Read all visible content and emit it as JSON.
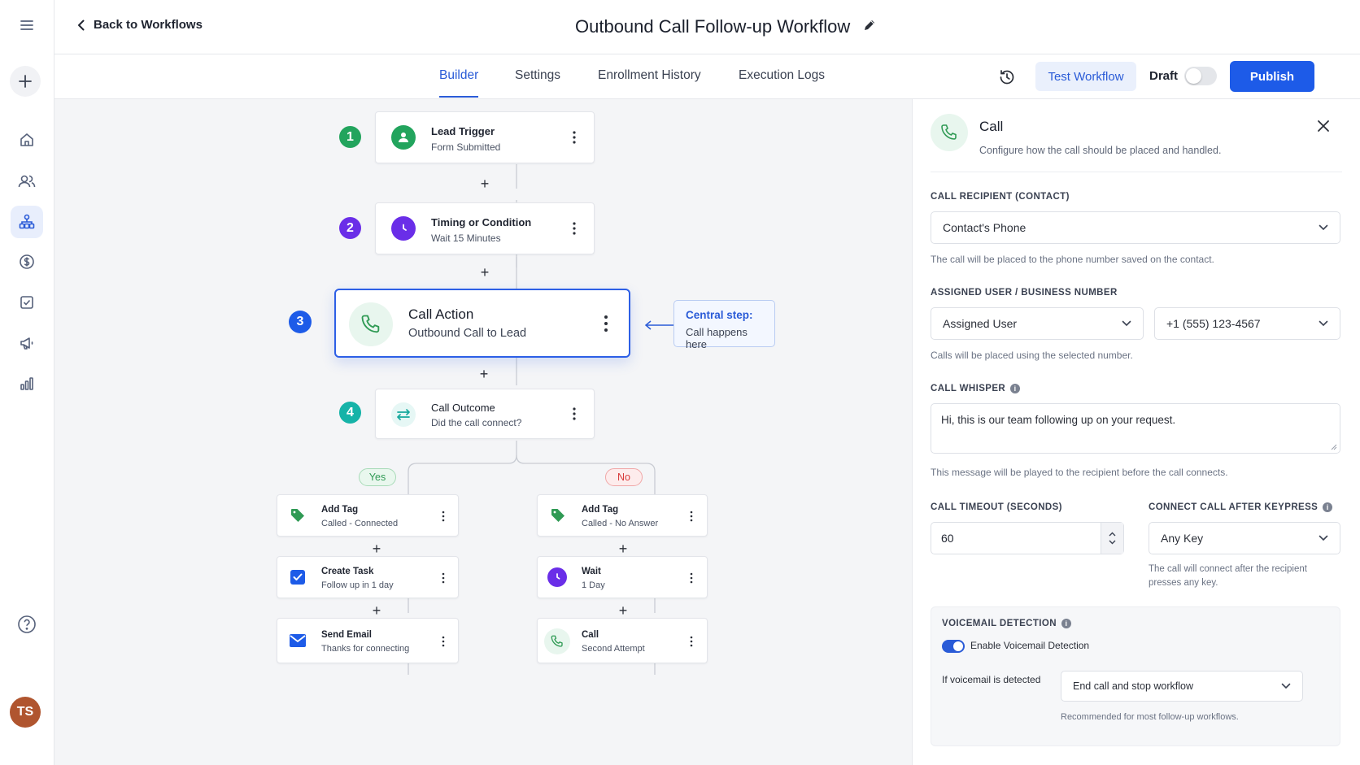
{
  "header": {
    "back_label": "Back to Workflows",
    "title": "Outbound Call Follow-up Workflow"
  },
  "tabs": [
    {
      "label": "Builder",
      "active": true
    },
    {
      "label": "Settings"
    },
    {
      "label": "Enrollment History"
    },
    {
      "label": "Execution Logs"
    }
  ],
  "actions": {
    "test_label": "Test Workflow",
    "draft_label": "Draft",
    "draft_enabled": false,
    "publish_label": "Publish"
  },
  "sidebar": {
    "icons": [
      "menu-icon",
      "plus-icon",
      "home-icon",
      "contacts-icon",
      "workflow-icon",
      "billing-icon",
      "tasks-icon",
      "marketing-icon",
      "reporting-icon",
      "help-icon"
    ],
    "active": "workflow-icon",
    "avatar_initials": "TS"
  },
  "workflow": {
    "steps": [
      {
        "num": "1",
        "title": "Lead Trigger",
        "subtitle": "Form Submitted",
        "color": "#22a45d"
      },
      {
        "num": "2",
        "title": "Timing or Condition",
        "subtitle": "Wait 15 Minutes",
        "color": "#6a2ee8"
      },
      {
        "num": "3",
        "title": "Call Action",
        "subtitle": "Outbound Call to Lead",
        "color": "#1d5be8"
      },
      {
        "num": "4",
        "title": "Call Outcome",
        "subtitle": "Did the call connect?",
        "color": "#16b3a8"
      }
    ],
    "callout": {
      "title": "Central step:",
      "text": "Call happens here"
    },
    "branches": {
      "yes_label": "Yes",
      "no_label": "No",
      "yes": [
        {
          "title": "Add Tag",
          "subtitle": "Called - Connected"
        },
        {
          "title": "Create Task",
          "subtitle": "Follow up in 1 day"
        },
        {
          "title": "Send Email",
          "subtitle": "Thanks for connecting"
        }
      ],
      "no": [
        {
          "title": "Add Tag",
          "subtitle": "Called - No Answer"
        },
        {
          "title": "Wait",
          "subtitle": "1 Day"
        },
        {
          "title": "Call",
          "subtitle": "Second Attempt"
        }
      ]
    }
  },
  "panel": {
    "title": "Call",
    "subtitle": "Configure how the call should be placed and handled.",
    "recipient": {
      "label": "CALL RECIPIENT (CONTACT)",
      "value": "Contact's Phone",
      "help": "The call will be placed to the phone number saved on the contact."
    },
    "assigned": {
      "label": "ASSIGNED USER / BUSINESS NUMBER",
      "user_value": "Assigned User",
      "number_value": "+1 (555) 123-4567",
      "help": "Calls will be placed using the selected number."
    },
    "whisper": {
      "label": "CALL WHISPER",
      "value": "Hi, this is our team following up on your request.",
      "help": "This message will be played to the recipient before the call connects."
    },
    "timeout": {
      "label": "CALL TIMEOUT (SECONDS)",
      "value": "60"
    },
    "keypress": {
      "label": "CONNECT CALL AFTER KEYPRESS",
      "value": "Any Key",
      "help": "The call will connect after the recipient presses any key."
    },
    "voicemail": {
      "label": "VOICEMAIL DETECTION",
      "toggle_label": "Enable Voicemail Detection",
      "enabled": true,
      "if_label": "If voicemail is detected",
      "action_value": "End call and stop workflow",
      "help": "Recommended for most follow-up workflows."
    }
  }
}
